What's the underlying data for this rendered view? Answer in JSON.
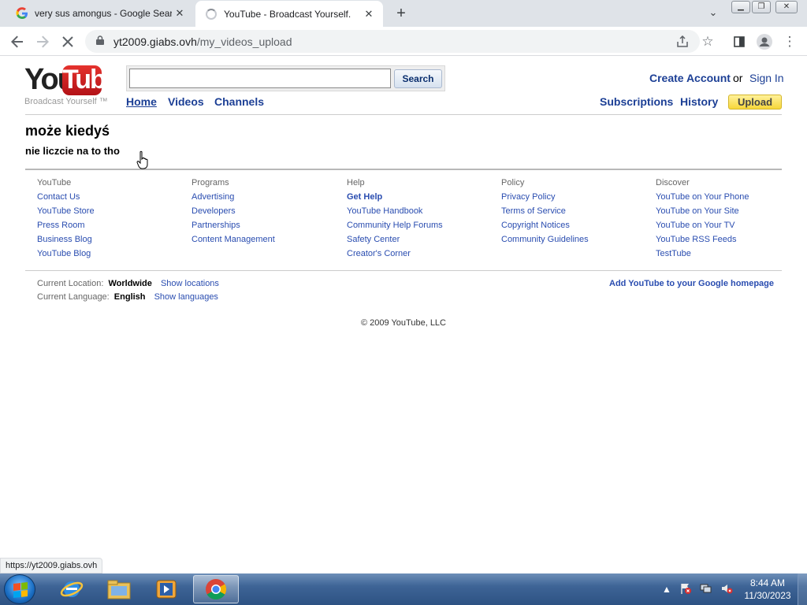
{
  "browser": {
    "tabs": [
      {
        "title": "very sus amongus - Google Search",
        "favicon": "google-icon",
        "active": false
      },
      {
        "title": "YouTube - Broadcast Yourself.",
        "favicon": "loading-spinner",
        "active": true
      }
    ],
    "url_host": "yt2009.giabs.ovh",
    "url_path": "/my_videos_upload",
    "status_url": "https://yt2009.giabs.ovh"
  },
  "site": {
    "logo_you": "You",
    "logo_tube": "Tube",
    "tagline": "Broadcast Yourself ™",
    "search": {
      "value": "",
      "button": "Search"
    },
    "nav": {
      "home": "Home",
      "videos": "Videos",
      "channels": "Channels"
    },
    "account": {
      "create": "Create Account",
      "or": "or",
      "signin": "Sign In"
    },
    "user_nav": {
      "subscriptions": "Subscriptions",
      "history": "History",
      "upload": "Upload"
    },
    "colors": {
      "link": "#1c3f95",
      "upload_bg": "#f7d73a",
      "logo_red": "#c8201e"
    }
  },
  "content": {
    "heading": "może kiedyś",
    "subheading": "nie liczcie na to tho"
  },
  "footer": {
    "columns": [
      {
        "head": "YouTube",
        "links": [
          "Contact Us",
          "YouTube Store",
          "Press Room",
          "Business Blog",
          "YouTube Blog"
        ]
      },
      {
        "head": "Programs",
        "links": [
          "Advertising",
          "Developers",
          "Partnerships",
          "Content Management"
        ]
      },
      {
        "head": "Help",
        "links": [
          "Get Help",
          "YouTube Handbook",
          "Community Help Forums",
          "Safety Center",
          "Creator's Corner"
        ]
      },
      {
        "head": "Policy",
        "links": [
          "Privacy Policy",
          "Terms of Service",
          "Copyright Notices",
          "Community Guidelines"
        ]
      },
      {
        "head": "Discover",
        "links": [
          "YouTube on Your Phone",
          "YouTube on Your Site",
          "YouTube on Your TV",
          "YouTube RSS Feeds",
          "TestTube"
        ]
      }
    ],
    "location_label": "Current Location:",
    "location_value": "Worldwide",
    "location_link": "Show locations",
    "language_label": "Current Language:",
    "language_value": "English",
    "language_link": "Show languages",
    "add_google": "Add YouTube to your Google homepage",
    "copyright": "© 2009 YouTube, LLC"
  },
  "taskbar": {
    "apps": [
      "internet-explorer-icon",
      "file-explorer-icon",
      "media-player-icon",
      "chrome-icon"
    ],
    "time": "8:44 AM",
    "date": "11/30/2023"
  }
}
